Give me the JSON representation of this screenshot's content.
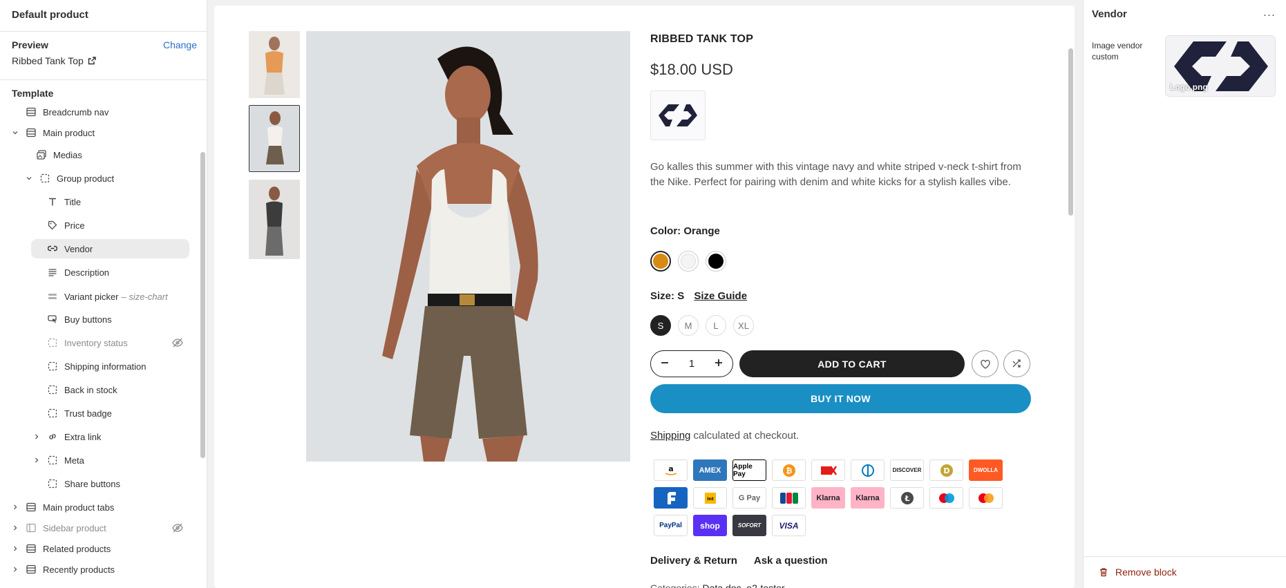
{
  "sidebar": {
    "header": "Default product",
    "preview_label": "Preview",
    "change_label": "Change",
    "preview_value": "Ribbed Tank Top",
    "template_label": "Template",
    "items": [
      {
        "label": "Breadcrumb nav"
      },
      {
        "label": "Main product"
      },
      {
        "label": "Medias"
      },
      {
        "label": "Group product"
      },
      {
        "label": "Title"
      },
      {
        "label": "Price"
      },
      {
        "label": "Vendor"
      },
      {
        "label": "Description"
      },
      {
        "label": "Variant picker",
        "sub": "– size-chart"
      },
      {
        "label": "Buy buttons"
      },
      {
        "label": "Inventory status"
      },
      {
        "label": "Shipping information"
      },
      {
        "label": "Back in stock"
      },
      {
        "label": "Trust badge"
      },
      {
        "label": "Extra link"
      },
      {
        "label": "Meta"
      },
      {
        "label": "Share buttons"
      },
      {
        "label": "Main product tabs"
      },
      {
        "label": "Sidebar product"
      },
      {
        "label": "Related products"
      },
      {
        "label": "Recently products"
      }
    ]
  },
  "product": {
    "title": "RIBBED TANK TOP",
    "price": "$18.00 USD",
    "description": "Go kalles this summer with this vintage navy and white striped v-neck t-shirt from the Nike. Perfect for pairing with denim and white kicks for a stylish kalles vibe.",
    "color_label": "Color:",
    "color_value": "Orange",
    "colors": [
      "#d88a12",
      "#f4f4f4",
      "#000000"
    ],
    "size_label": "Size:",
    "size_value": "S",
    "size_guide": "Size Guide",
    "sizes": [
      "S",
      "M",
      "L",
      "XL"
    ],
    "quantity": "1",
    "add_to_cart": "ADD TO CART",
    "buy_now": "BUY IT NOW",
    "shipping_link": "Shipping",
    "shipping_text": " calculated at checkout.",
    "payment_methods": [
      "amazon",
      "AMEX",
      "Apple Pay",
      "bitcoin",
      "dankort",
      "diners",
      "DISCOVER",
      "dogecoin",
      "DWOLLA",
      "forbrugsforeningen",
      "interac",
      "G Pay",
      "JCB",
      "Klarna",
      "Klarna",
      "litecoin",
      "maestro",
      "mastercard",
      "PayPal",
      "shop",
      "SOFORT",
      "VISA"
    ],
    "tab_delivery": "Delivery & Return",
    "tab_ask": "Ask a question",
    "categories_label": "Categories:",
    "categories_value": "Data doc, e2-tester"
  },
  "panel": {
    "title": "Vendor",
    "menu": "···",
    "image_label": "Image vendor custom",
    "image_filename": "Logo.png",
    "remove_block": "Remove block"
  },
  "colors": {
    "accent": "#2c6ecb",
    "buy_now": "#1a8fc4",
    "remove": "#8e1f0b"
  }
}
